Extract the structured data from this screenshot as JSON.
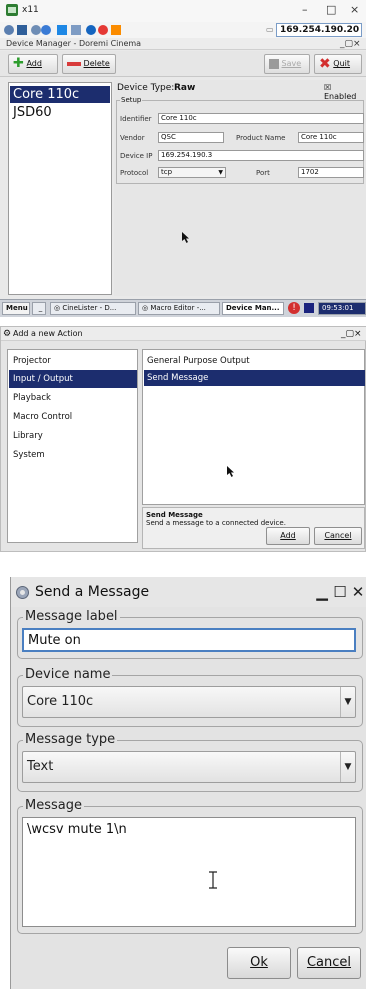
{
  "panel1": {
    "x11_title": "x11",
    "window_controls": [
      "–",
      "□",
      "×"
    ],
    "ip_address": "169.254.190.20",
    "app_title": "Device Manager - Doremi Cinema",
    "toolbar": {
      "add": "Add",
      "delete": "Delete",
      "save": "Save",
      "quit": "Quit"
    },
    "devices": [
      "Core 110c",
      "JSD60"
    ],
    "device_type_label": "Device Type:",
    "device_type": "Raw",
    "enabled_label": "Enabled",
    "setup_legend": "Setup",
    "identifier_label": "Identifier",
    "identifier": "Core 110c",
    "vendor_label": "Vendor",
    "vendor": "QSC",
    "product_name_label": "Product Name",
    "product_name": "Core 110c",
    "device_ip_label": "Device IP",
    "device_ip": "169.254.190.3",
    "protocol_label": "Protocol",
    "protocol": "tcp",
    "port_label": "Port",
    "port": "1702",
    "taskbar": {
      "menu": "Menu",
      "tasks": [
        "CineLister - D...",
        "Macro Editor -...",
        "Device Man..."
      ],
      "clock": "09:53:01"
    }
  },
  "panel2": {
    "title": "Add a new Action",
    "categories": [
      "Projector",
      "Input / Output",
      "Playback",
      "Macro Control",
      "Library",
      "System"
    ],
    "actions": [
      "General Purpose Output",
      "Send Message"
    ],
    "desc_title": "Send Message",
    "desc_text": "Send a message to a connected device.",
    "add_btn": "Add",
    "cancel_btn": "Cancel"
  },
  "panel3": {
    "title": "Send a Message",
    "message_label_legend": "Message label",
    "message_label_value": "Mute on",
    "device_name_legend": "Device name",
    "device_name_value": "Core 110c",
    "message_type_legend": "Message type",
    "message_type_value": "Text",
    "message_legend": "Message",
    "message_value": "\\wcsv mute 1\\n",
    "ok_btn": "Ok",
    "cancel_btn": "Cancel"
  },
  "colors": {
    "selection": "#1c2d6e",
    "accent_blue": "#7a9cc7"
  }
}
